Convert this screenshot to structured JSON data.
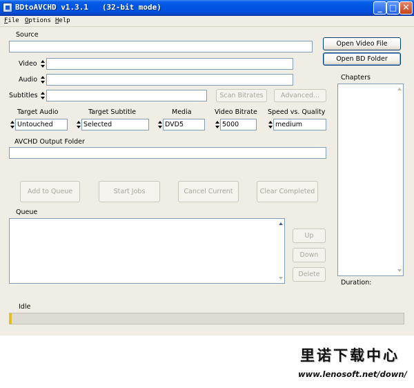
{
  "window": {
    "title": "BDtoAVCHD v1.3.1   (32-bit mode)",
    "controls": {
      "minimize": "_",
      "maximize": "□",
      "close": "✕"
    }
  },
  "menu": [
    "File",
    "Options",
    "Help"
  ],
  "source": {
    "label": "Source",
    "value": ""
  },
  "open_video_file": "Open Video File",
  "open_bd_folder": "Open BD Folder",
  "chapters": {
    "label": "Chapters",
    "duration_label": "Duration:"
  },
  "video": {
    "label": "Video",
    "value": ""
  },
  "audio": {
    "label": "Audio",
    "value": ""
  },
  "subtitles": {
    "label": "Subtitles",
    "value": ""
  },
  "scan_bitrates": "Scan Bitrates",
  "advanced": "Advanced...",
  "options": [
    {
      "label": "Target Audio",
      "value": "Untouched"
    },
    {
      "label": "Target Subtitle",
      "value": "Selected"
    },
    {
      "label": "Media",
      "value": "DVD5"
    },
    {
      "label": "Video Bitrate",
      "value": "5000"
    },
    {
      "label": "Speed vs. Quality",
      "value": "medium"
    }
  ],
  "output_folder": {
    "label": "AVCHD Output Folder",
    "value": ""
  },
  "actions": {
    "add_to_queue": "Add to Queue",
    "start_jobs": "Start Jobs",
    "cancel_current": "Cancel Current",
    "clear_completed": "Clear Completed"
  },
  "queue": {
    "label": "Queue",
    "up": "Up",
    "down": "Down",
    "delete": "Delete"
  },
  "status": {
    "text": "Idle",
    "progress": 0.0
  },
  "watermark": {
    "chinese": "里诺下载中心",
    "url": "www.lenosoft.net/down/"
  }
}
